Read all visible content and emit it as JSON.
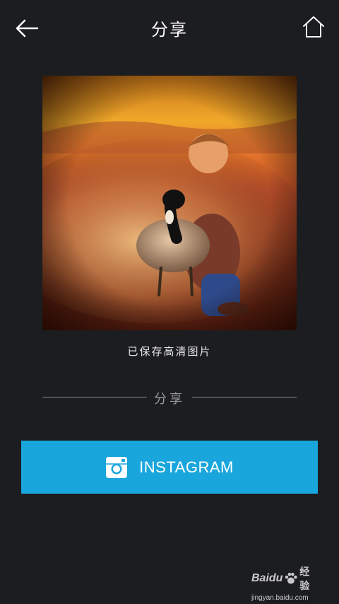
{
  "header": {
    "title": "分享",
    "back_icon": "back-arrow-icon",
    "home_icon": "home-icon"
  },
  "preview": {
    "saved_message": "已保存高清图片"
  },
  "share": {
    "section_label": "分享",
    "instagram_label": "INSTAGRAM",
    "instagram_icon": "instagram-icon"
  },
  "watermark": {
    "brand": "Baidu",
    "brand_suffix": "经验",
    "url": "jingyan.baidu.com"
  },
  "colors": {
    "background": "#1c1d20",
    "accent": "#19a6dc",
    "divider": "#8a8a8a"
  }
}
